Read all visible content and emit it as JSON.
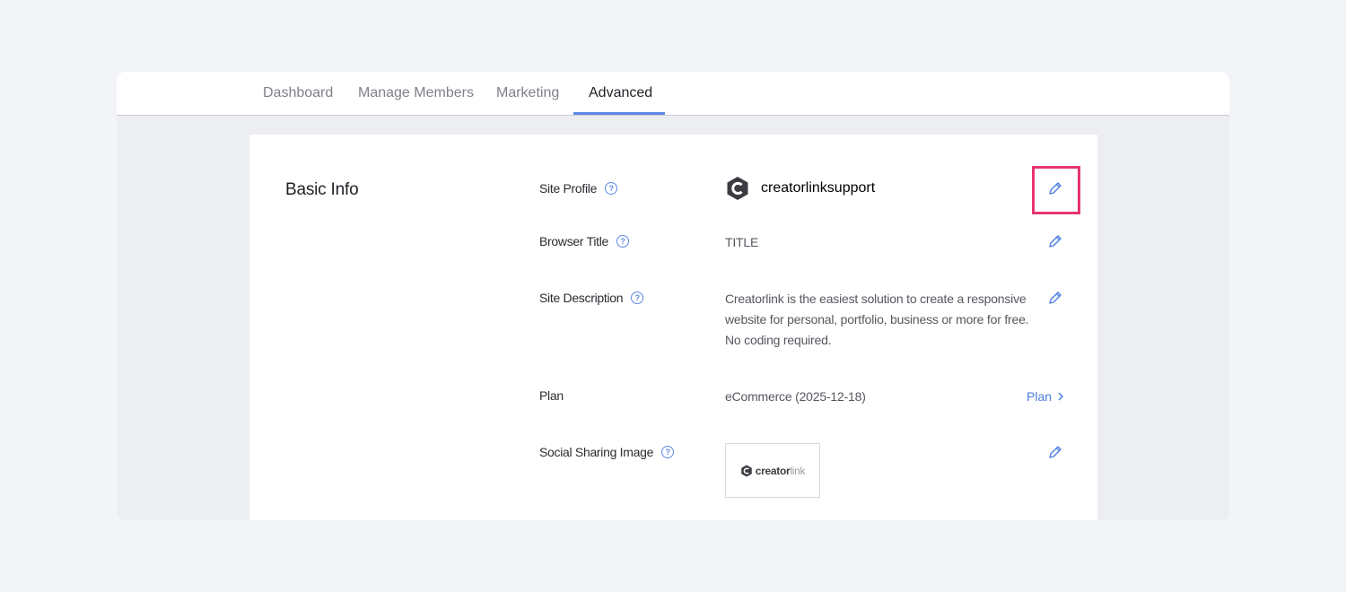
{
  "tabs": {
    "dashboard": "Dashboard",
    "manage_members": "Manage Members",
    "marketing": "Marketing",
    "advanced": "Advanced"
  },
  "section": {
    "title": "Basic Info"
  },
  "fields": {
    "site_profile": {
      "label": "Site Profile",
      "value": "creatorlinksupport"
    },
    "browser_title": {
      "label": "Browser Title",
      "value": "TITLE"
    },
    "site_description": {
      "label": "Site Description",
      "value": "Creatorlink is the easiest solution to create a responsive website for personal, portfolio, business or more for free. No coding required."
    },
    "plan": {
      "label": "Plan",
      "value": "eCommerce (2025-12-18)",
      "link_label": "Plan"
    },
    "social_sharing_image": {
      "label": "Social Sharing Image",
      "logo_text_bold": "creator",
      "logo_text_light": "link"
    }
  },
  "colors": {
    "accent": "#5f88e6",
    "highlight": "#e8346f"
  }
}
